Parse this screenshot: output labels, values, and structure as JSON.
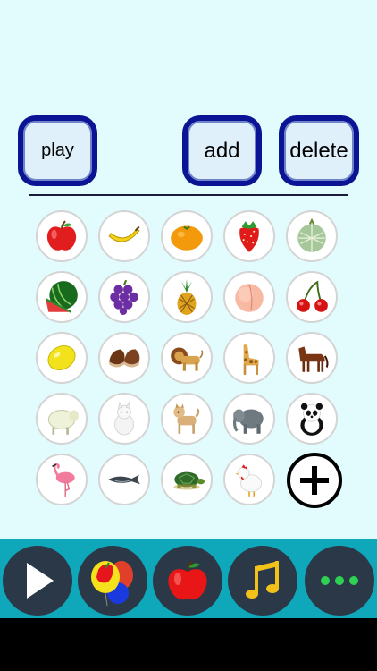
{
  "controls": {
    "play_label": "play",
    "add_label": "add",
    "delete_label": "delete"
  },
  "grid": {
    "items": [
      {
        "name": "apple-icon"
      },
      {
        "name": "banana-icon"
      },
      {
        "name": "orange-icon"
      },
      {
        "name": "strawberry-icon"
      },
      {
        "name": "melon-icon"
      },
      {
        "name": "watermelon-icon"
      },
      {
        "name": "grapes-icon"
      },
      {
        "name": "pineapple-icon"
      },
      {
        "name": "peach-icon"
      },
      {
        "name": "cherry-icon"
      },
      {
        "name": "lemon-icon"
      },
      {
        "name": "chestnut-icon"
      },
      {
        "name": "lion-icon"
      },
      {
        "name": "giraffe-icon"
      },
      {
        "name": "horse-icon"
      },
      {
        "name": "sheep-icon"
      },
      {
        "name": "cat-icon"
      },
      {
        "name": "dog-icon"
      },
      {
        "name": "elephant-icon"
      },
      {
        "name": "panda-icon"
      },
      {
        "name": "flamingo-icon"
      },
      {
        "name": "whale-icon"
      },
      {
        "name": "turtle-icon"
      },
      {
        "name": "chicken-icon"
      },
      {
        "name": "add-item-icon"
      }
    ]
  },
  "tabs": [
    {
      "name": "play-icon"
    },
    {
      "name": "balloons-icon"
    },
    {
      "name": "apple-icon"
    },
    {
      "name": "music-note-icon"
    },
    {
      "name": "more-dots-icon"
    }
  ],
  "colors": {
    "background": "#e2fbfd",
    "button_border": "#0b1494",
    "bottom_bar": "#0fa7ba",
    "tab_bg": "#2b3848",
    "more_dots": "#2ed253"
  }
}
